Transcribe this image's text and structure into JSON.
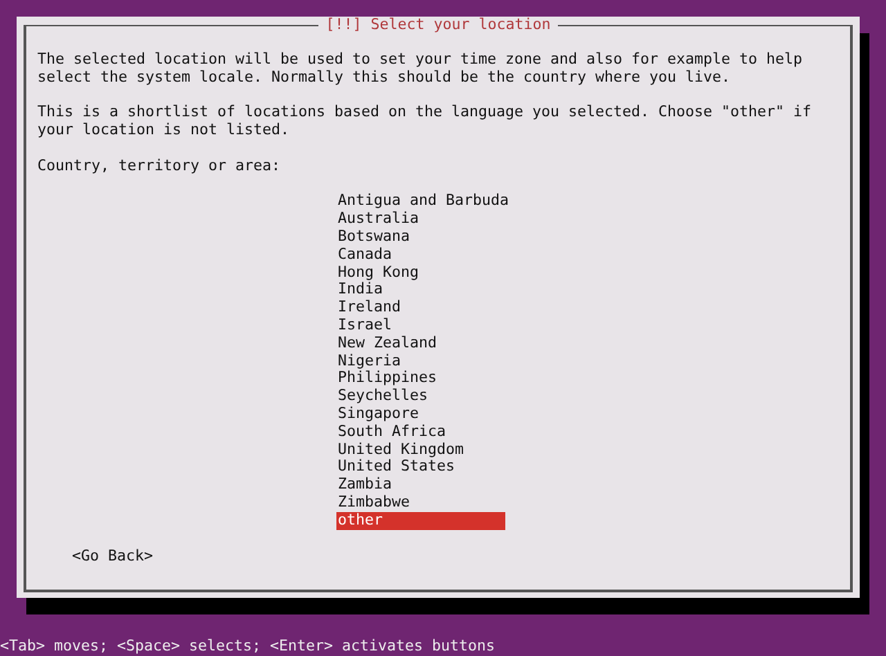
{
  "dialog": {
    "title": "[!!] Select your location",
    "paragraphs": [
      "The selected location will be used to set your time zone and also for example to help select the system locale. Normally this should be the country where you live.",
      "This is a shortlist of locations based on the language you selected. Choose \"other\" if your location is not listed."
    ],
    "prompt": "Country, territory or area:",
    "items": [
      {
        "label": "Antigua and Barbuda",
        "selected": false
      },
      {
        "label": "Australia",
        "selected": false
      },
      {
        "label": "Botswana",
        "selected": false
      },
      {
        "label": "Canada",
        "selected": false
      },
      {
        "label": "Hong Kong",
        "selected": false
      },
      {
        "label": "India",
        "selected": false
      },
      {
        "label": "Ireland",
        "selected": false
      },
      {
        "label": "Israel",
        "selected": false
      },
      {
        "label": "New Zealand",
        "selected": false
      },
      {
        "label": "Nigeria",
        "selected": false
      },
      {
        "label": "Philippines",
        "selected": false
      },
      {
        "label": "Seychelles",
        "selected": false
      },
      {
        "label": "Singapore",
        "selected": false
      },
      {
        "label": "South Africa",
        "selected": false
      },
      {
        "label": "United Kingdom",
        "selected": false
      },
      {
        "label": "United States",
        "selected": false
      },
      {
        "label": "Zambia",
        "selected": false
      },
      {
        "label": "Zimbabwe",
        "selected": false
      },
      {
        "label": "other",
        "selected": true
      }
    ],
    "buttons": [
      "<Go Back>"
    ]
  },
  "status_bar": "<Tab> moves; <Space> selects; <Enter> activates buttons"
}
